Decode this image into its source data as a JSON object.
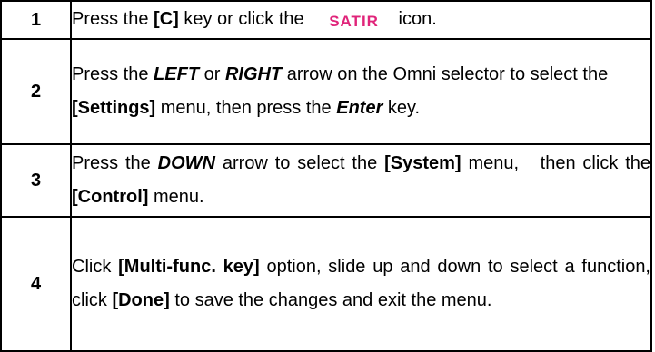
{
  "steps": [
    {
      "num": "1",
      "parts": [
        "Press the ",
        "[C]",
        " key or click the ",
        " icon."
      ],
      "icon_text": "SATIR"
    },
    {
      "num": "2",
      "parts": [
        "Press the ",
        "LEFT",
        " or ",
        "RIGHT",
        " arrow on the Omni selector to select the ",
        "[Settings]",
        " menu, then press the ",
        "Enter",
        " key."
      ]
    },
    {
      "num": "3",
      "parts": [
        "Press the ",
        "DOWN",
        " arrow to select the ",
        "[System]",
        " menu,   then click the ",
        "[Control]",
        " menu."
      ]
    },
    {
      "num": "4",
      "parts": [
        "Click ",
        "[Multi-func. key]",
        " option, slide up and down to select a function, click ",
        "[Done]",
        " to save the changes and exit the menu."
      ]
    }
  ],
  "colors": {
    "icon": "#e0247a",
    "border": "#000000"
  },
  "icons": {
    "step1": "satir-logo-icon"
  }
}
